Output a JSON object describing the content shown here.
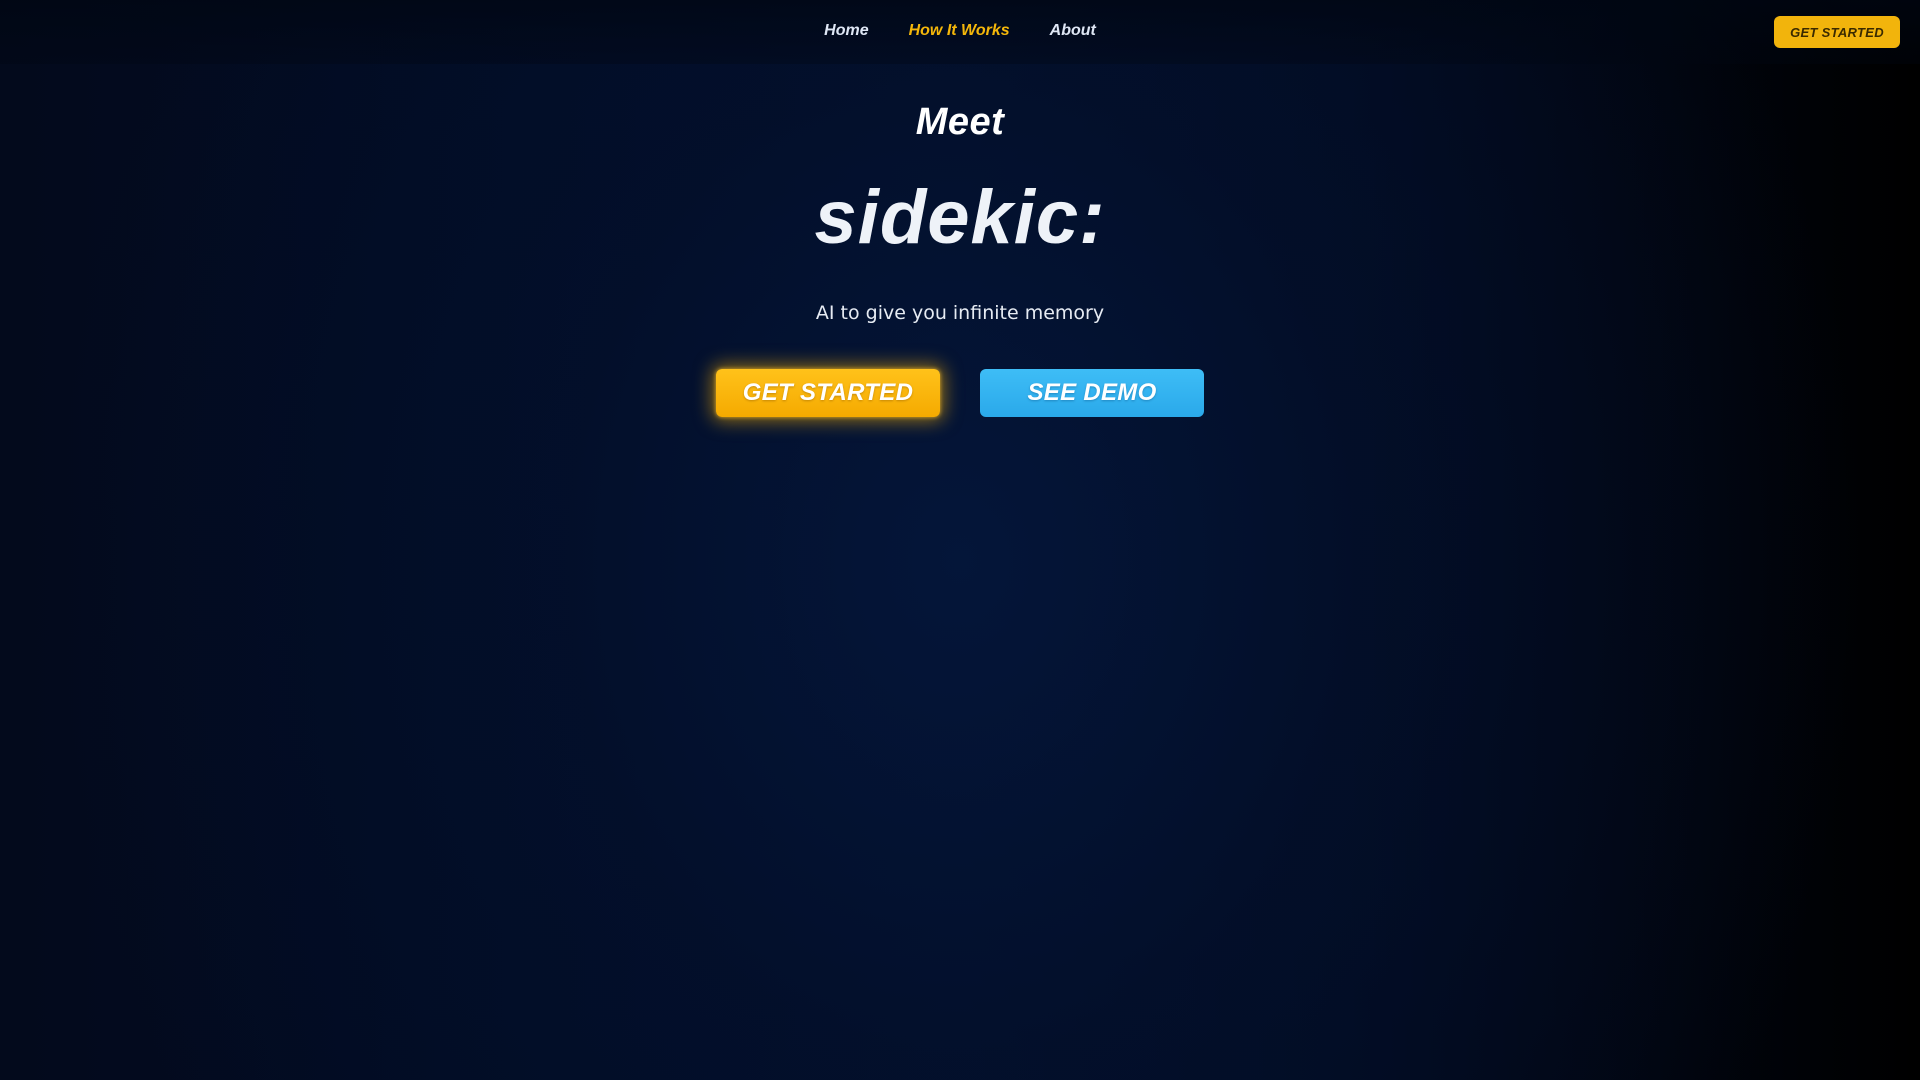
{
  "nav": {
    "links": [
      {
        "label": "Home",
        "active": false
      },
      {
        "label": "How It Works",
        "active": true
      },
      {
        "label": "About",
        "active": false
      }
    ],
    "cta_label": "GET STARTED"
  },
  "hero": {
    "kicker": "Meet",
    "brand": "sidekic:",
    "tagline": "AI to give you infinite memory",
    "primary_label": "GET STARTED",
    "secondary_label": "SEE DEMO"
  },
  "colors": {
    "accent_yellow": "#f5b70a",
    "accent_blue": "#35b5f3",
    "background": "#020c26"
  }
}
